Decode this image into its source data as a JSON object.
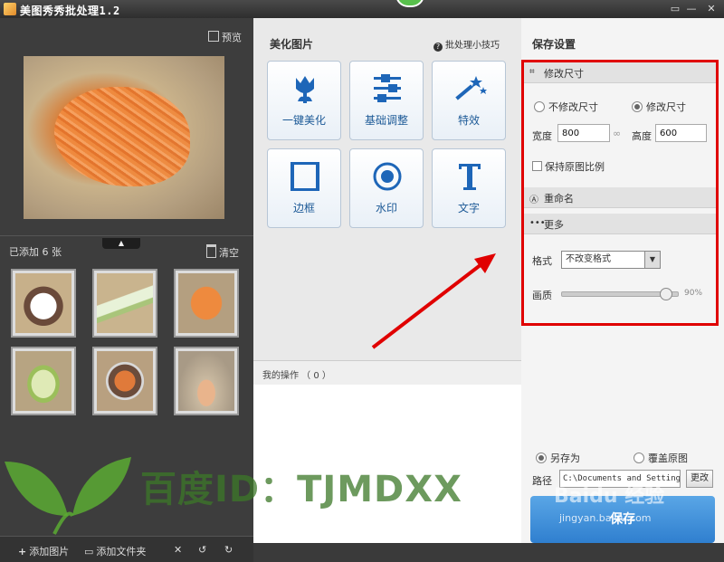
{
  "window": {
    "title": "美图秀秀批处理1.2"
  },
  "left": {
    "preview_label": "预览",
    "added_count": "已添加 6 张",
    "clear_label": "清空",
    "toggle": "▲",
    "bottom": {
      "add_image": "添加图片",
      "add_folder": "添加文件夹"
    }
  },
  "middle": {
    "title": "美化图片",
    "tips": "批处理小技巧",
    "tools": [
      "一键美化",
      "基础调整",
      "特效",
      "边框",
      "水印",
      "文字"
    ],
    "my_ops": "我的操作 （ 0 ）"
  },
  "right": {
    "title": "保存设置",
    "resize": {
      "header": "修改尺寸",
      "no_resize": "不修改尺寸",
      "do_resize": "修改尺寸",
      "width_label": "宽度",
      "width_value": "800",
      "height_label": "高度",
      "height_value": "600",
      "keep_ratio": "保持原图比例"
    },
    "rename": {
      "header": "重命名"
    },
    "more": {
      "header": "更多",
      "format_label": "格式",
      "format_value": "不改变格式",
      "quality_label": "画质",
      "quality_value": "90%",
      "quality_level": 0.9
    },
    "save_mode": {
      "save_as": "另存为",
      "overwrite": "覆盖原图"
    },
    "path_label": "路径",
    "path_value": "C:\\Documents and Settings\\",
    "change_label": "更改",
    "save_button": "保存"
  },
  "overlay": {
    "watermark": "百度ID：TJMDXX",
    "baidu": "Baidu 经验",
    "baidu_url": "jingyan.baidu.com"
  },
  "colors": {
    "accent": "#2f7fcf",
    "highlight_box": "#e00000",
    "watermark": "#3c7828"
  }
}
